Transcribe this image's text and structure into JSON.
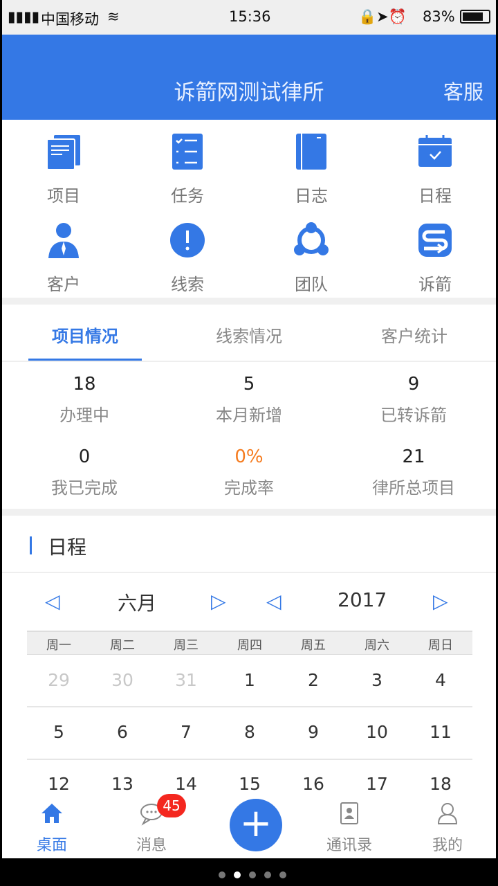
{
  "status": {
    "carrier": "中国移动",
    "time": "15:36",
    "battery": "83%"
  },
  "header": {
    "title": "诉箭网测试律所",
    "service": "客服"
  },
  "grid": [
    {
      "label": "项目",
      "icon": "documents-icon"
    },
    {
      "label": "任务",
      "icon": "checklist-icon"
    },
    {
      "label": "日志",
      "icon": "notebook-icon"
    },
    {
      "label": "日程",
      "icon": "calendar-icon"
    },
    {
      "label": "客户",
      "icon": "client-icon"
    },
    {
      "label": "线索",
      "icon": "alert-icon"
    },
    {
      "label": "团队",
      "icon": "team-icon"
    },
    {
      "label": "诉箭",
      "icon": "exchange-icon"
    }
  ],
  "tabs": [
    "项目情况",
    "线索情况",
    "客户统计"
  ],
  "stats": [
    {
      "value": "18",
      "label": "办理中"
    },
    {
      "value": "5",
      "label": "本月新增"
    },
    {
      "value": "9",
      "label": "已转诉箭"
    },
    {
      "value": "0",
      "label": "我已完成"
    },
    {
      "value": "0%",
      "label": "完成率"
    },
    {
      "value": "21",
      "label": "律所总项目"
    }
  ],
  "schedule": {
    "title": "日程",
    "month": "六月",
    "year": "2017",
    "weekdays": [
      "周一",
      "周二",
      "周三",
      "周四",
      "周五",
      "周六",
      "周日"
    ],
    "rows": [
      [
        "29",
        "30",
        "31",
        "1",
        "2",
        "3",
        "4"
      ],
      [
        "5",
        "6",
        "7",
        "8",
        "9",
        "10",
        "11"
      ],
      [
        "12",
        "13",
        "14",
        "15",
        "16",
        "17",
        "18"
      ]
    ]
  },
  "tabbar": {
    "items": [
      "桌面",
      "消息",
      "通讯录",
      "我的"
    ],
    "badge": "45"
  },
  "colors": {
    "accent": "#3478e5",
    "highlight": "#f57c20",
    "badge": "#f4271f"
  }
}
